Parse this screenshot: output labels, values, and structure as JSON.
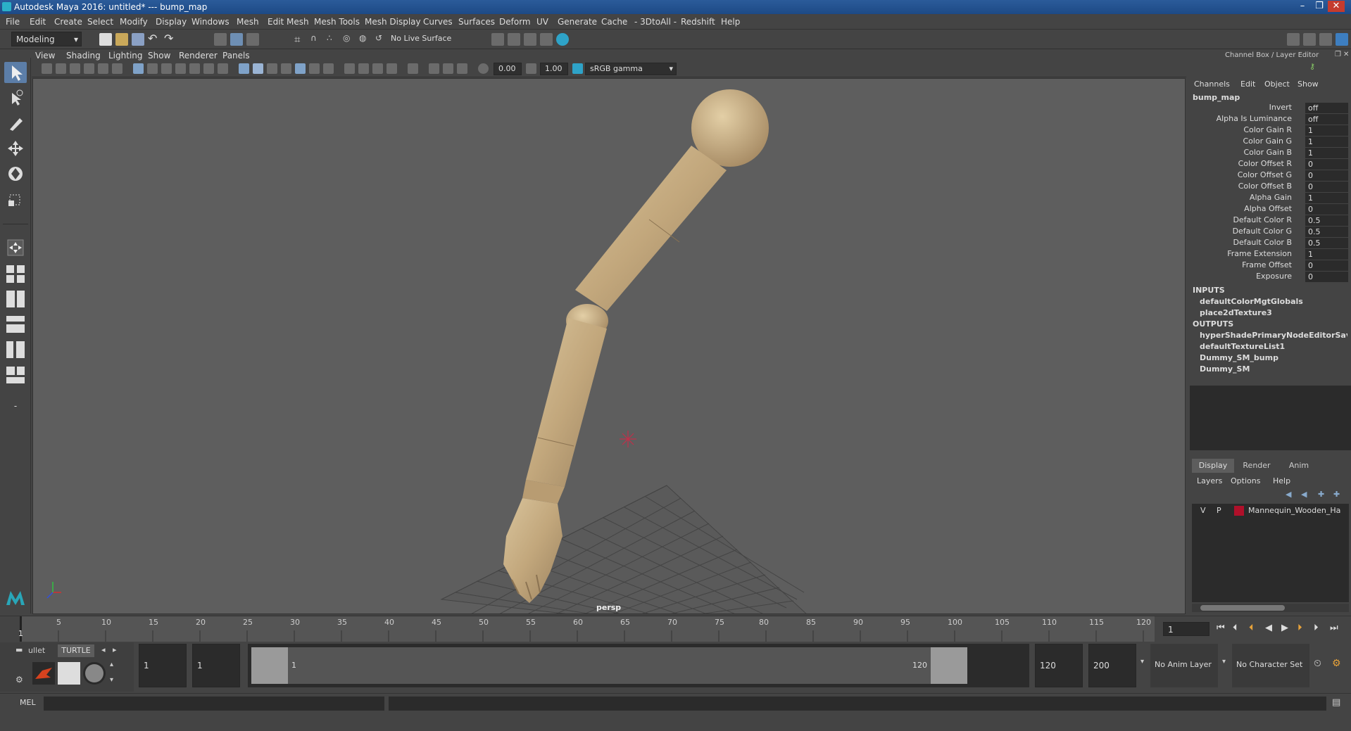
{
  "window": {
    "title": "Autodesk Maya 2016: untitled*   ---   bump_map"
  },
  "menubar": {
    "items": [
      "File",
      "Edit",
      "Create",
      "Select",
      "Modify",
      "Display",
      "Windows",
      "Mesh",
      "Edit Mesh",
      "Mesh Tools",
      "Mesh Display",
      "Curves",
      "Surfaces",
      "Deform",
      "UV",
      "Generate",
      "Cache",
      "- 3DtoAll -",
      "Redshift",
      "Help"
    ]
  },
  "statusline": {
    "menuset": "Modeling",
    "live_surface": "No Live Surface"
  },
  "viewport_menu": {
    "items": [
      "View",
      "Shading",
      "Lighting",
      "Show",
      "Renderer",
      "Panels"
    ]
  },
  "viewport_toolbar": {
    "exposure": "0.00",
    "gamma": "1.00",
    "color_space": "sRGB gamma"
  },
  "viewport": {
    "camera_label": "persp"
  },
  "channel_box": {
    "panel_title": "Channel Box / Layer Editor",
    "menu": [
      "Channels",
      "Edit",
      "Object",
      "Show"
    ],
    "node_name": "bump_map",
    "attributes": [
      {
        "label": "Invert",
        "value": "off"
      },
      {
        "label": "Alpha Is Luminance",
        "value": "off"
      },
      {
        "label": "Color Gain R",
        "value": "1"
      },
      {
        "label": "Color Gain G",
        "value": "1"
      },
      {
        "label": "Color Gain B",
        "value": "1"
      },
      {
        "label": "Color Offset R",
        "value": "0"
      },
      {
        "label": "Color Offset G",
        "value": "0"
      },
      {
        "label": "Color Offset B",
        "value": "0"
      },
      {
        "label": "Alpha Gain",
        "value": "1"
      },
      {
        "label": "Alpha Offset",
        "value": "0"
      },
      {
        "label": "Default Color R",
        "value": "0.5"
      },
      {
        "label": "Default Color G",
        "value": "0.5"
      },
      {
        "label": "Default Color B",
        "value": "0.5"
      },
      {
        "label": "Frame Extension",
        "value": "1"
      },
      {
        "label": "Frame Offset",
        "value": "0"
      },
      {
        "label": "Exposure",
        "value": "0"
      }
    ],
    "inputs_label": "INPUTS",
    "inputs": [
      "defaultColorMgtGlobals",
      "place2dTexture3"
    ],
    "outputs_label": "OUTPUTS",
    "outputs": [
      "hyperShadePrimaryNodeEditorSavedT...",
      "defaultTextureList1",
      "Dummy_SM_bump",
      "Dummy_SM"
    ]
  },
  "layer_editor": {
    "tabs": [
      "Display",
      "Render",
      "Anim"
    ],
    "menu": [
      "Layers",
      "Options",
      "Help"
    ],
    "layer": {
      "v": "V",
      "p": "P",
      "name": "Mannequin_Wooden_Ha",
      "color": "#b0102a"
    }
  },
  "timeline": {
    "ticks": [
      "1",
      "5",
      "10",
      "15",
      "20",
      "25",
      "30",
      "35",
      "40",
      "45",
      "50",
      "55",
      "60",
      "65",
      "70",
      "75",
      "80",
      "85",
      "90",
      "95",
      "100",
      "105",
      "110",
      "115",
      "120"
    ],
    "current_frame": "1"
  },
  "range": {
    "shelf_tabs": [
      "ullet",
      "TURTLE"
    ],
    "start": "1",
    "playback_start": "1",
    "slider_start": "1",
    "slider_end": "120",
    "playback_end": "120",
    "end": "200",
    "anim_layer": "No Anim Layer",
    "character_set": "No Character Set"
  },
  "command_line": {
    "label": "MEL"
  }
}
